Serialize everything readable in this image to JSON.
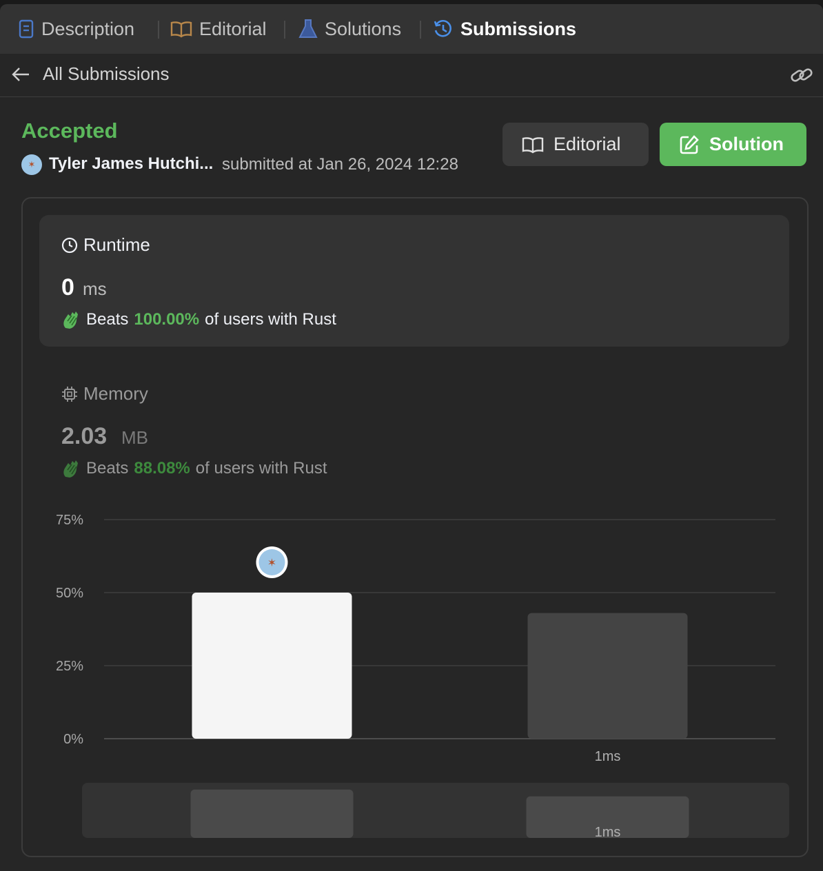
{
  "tabs": [
    {
      "label": "Description",
      "icon": "description-icon",
      "active": false
    },
    {
      "label": "Editorial",
      "icon": "book-icon",
      "active": false
    },
    {
      "label": "Solutions",
      "icon": "flask-icon",
      "active": false
    },
    {
      "label": "Submissions",
      "icon": "history-icon",
      "active": true
    }
  ],
  "subheader": {
    "back_label": "All Submissions"
  },
  "submission": {
    "status": "Accepted",
    "user": "Tyler James Hutchi...",
    "submitted_at": "submitted at Jan 26, 2024 12:28"
  },
  "buttons": {
    "editorial": "Editorial",
    "solution": "Solution"
  },
  "runtime": {
    "label": "Runtime",
    "value": "0",
    "unit": "ms",
    "beats_label": "Beats",
    "beats_pct": "100.00%",
    "beats_suffix": "of users with Rust"
  },
  "memory": {
    "label": "Memory",
    "value": "2.03",
    "unit": "MB",
    "beats_label": "Beats",
    "beats_pct": "88.08%",
    "beats_suffix": "of users with Rust"
  },
  "colors": {
    "accent_green": "#5cb85c",
    "bar_selected": "#f5f5f5",
    "bar_other": "#444444"
  },
  "chart_data": {
    "type": "bar",
    "categories": [
      "",
      "1ms"
    ],
    "values": [
      50,
      43
    ],
    "highlight_index": 0,
    "ylim": [
      0,
      75
    ],
    "yticks": [
      "75%",
      "50%",
      "25%",
      "0%"
    ],
    "grid": true,
    "overview_labels": [
      "",
      "1ms"
    ]
  }
}
